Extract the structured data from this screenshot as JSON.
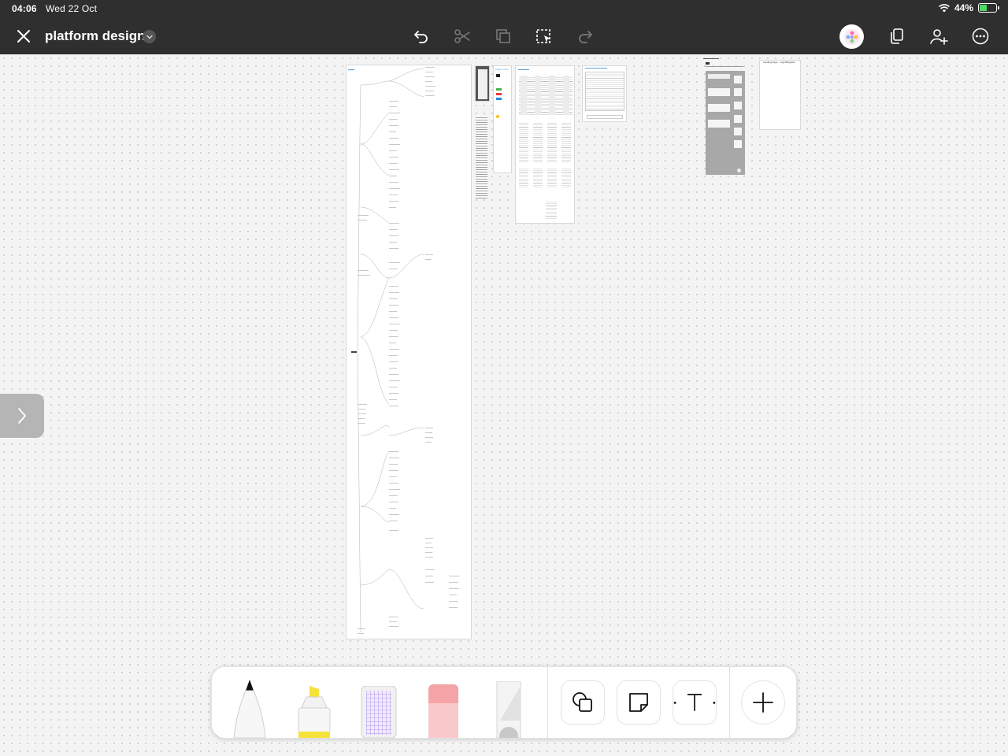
{
  "status_bar": {
    "time": "04:06",
    "date": "Wed 22 Oct",
    "battery": "44%",
    "battery_level": 0.44
  },
  "toolbar": {
    "document_title": "platform design"
  },
  "canvas": {
    "board_labels": [
      "Landing Page · Login/Register",
      "Pages Color"
    ]
  },
  "colors": {
    "toolbar_bg": "#2f2f2f",
    "canvas_bg": "#f4f4f4",
    "marker_yellow": "#f5e23a",
    "eraser_pink": "#f4a3a6",
    "battery_green": "#4cd964"
  },
  "palette": {
    "drawing_tools": [
      "pen-icon",
      "highlighter-icon",
      "ruler-tape-icon",
      "eraser-icon",
      "lasso-ruler-icon"
    ],
    "insert_tools": [
      "shapes-icon",
      "sticky-note-icon",
      "text-icon",
      "plus-icon"
    ]
  }
}
